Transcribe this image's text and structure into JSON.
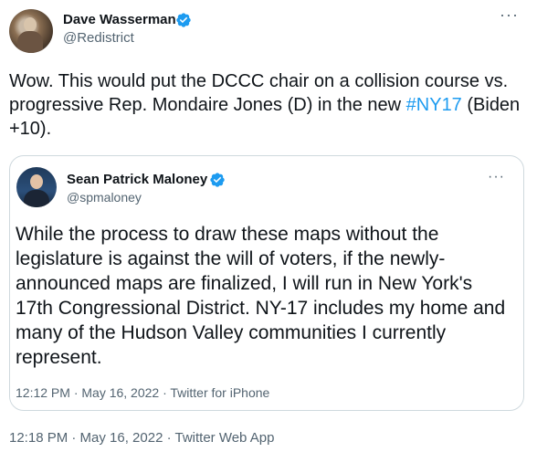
{
  "author": {
    "name": "Dave Wasserman",
    "handle": "@Redistrict"
  },
  "tweet": {
    "text_before": "Wow. This would put the DCCC chair on a collision course vs. progressive Rep. Mondaire Jones (D) in the new ",
    "hashtag": "#NY17",
    "text_after": " (Biden +10).",
    "meta": "12:18 PM · May 16, 2022 · Twitter Web App"
  },
  "quoted": {
    "name": "Sean Patrick Maloney",
    "handle": "@spmaloney",
    "text": "While the process to draw these maps without the legislature is against the will of voters, if the newly-announced maps are finalized, I will run in New York's 17th Congressional District. NY-17 includes my home and many of the Hudson Valley communities I currently represent.",
    "meta": "12:12 PM · May 16, 2022 · Twitter for iPhone"
  },
  "icons": {
    "verified": "verified-badge-icon",
    "more": "more-options-icon"
  },
  "colors": {
    "link": "#1d9bf0",
    "secondary_text": "#536471",
    "border": "#cfd9de",
    "verified": "#1d9bf0"
  },
  "more_glyph": "···"
}
